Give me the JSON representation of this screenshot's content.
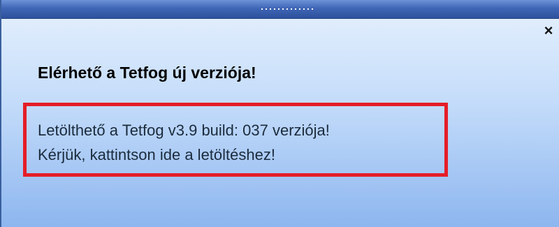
{
  "notification": {
    "title": "Elérhető a Tetfog új verziója!",
    "close_label": "×",
    "message": {
      "line1": "Letölthető a Tetfog v3.9 build: 037 verziója!",
      "line2": "Kérjük, kattintson ide a letöltéshez!"
    },
    "highlight_color": "#e51d27"
  }
}
